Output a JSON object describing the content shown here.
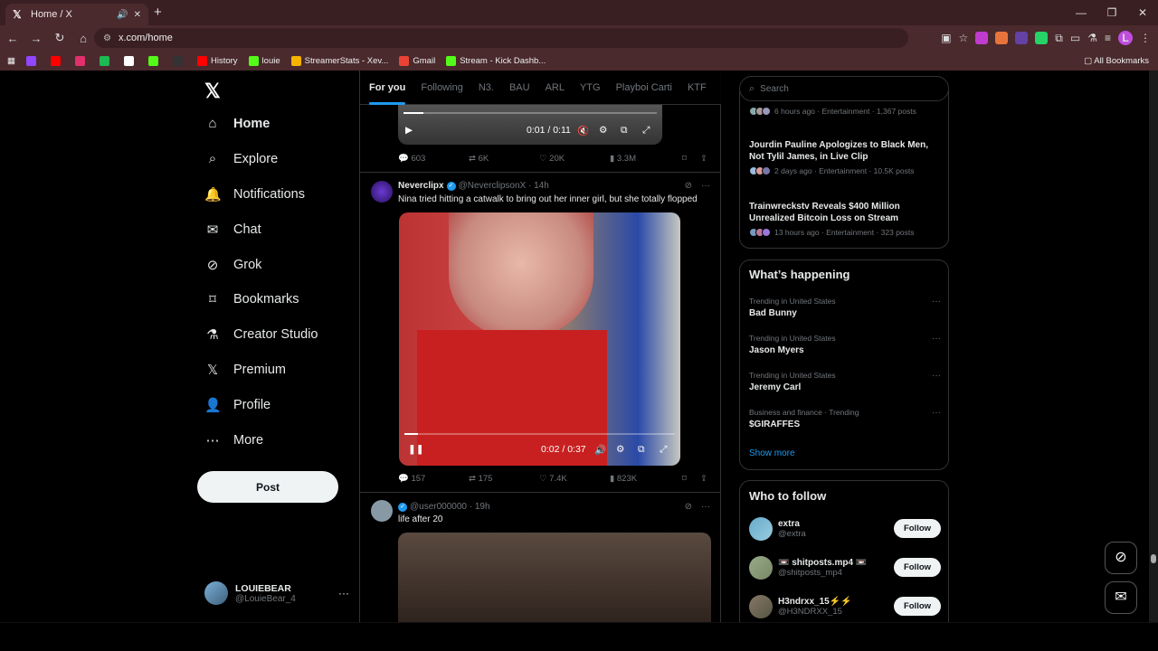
{
  "browser": {
    "tab_title": "Home / X",
    "url": "x.com/home",
    "bookmarks": [
      {
        "label": "",
        "color": "#9146ff"
      },
      {
        "label": "",
        "color": "#ff0000"
      },
      {
        "label": "",
        "color": "#e1306c"
      },
      {
        "label": "",
        "color": "#1db954"
      },
      {
        "label": "",
        "color": "#ffffff"
      },
      {
        "label": "",
        "color": "#53fc18"
      },
      {
        "label": "",
        "color": "#333333"
      },
      {
        "label": "History",
        "color": "#ff0000"
      },
      {
        "label": "louie",
        "color": "#53fc18"
      },
      {
        "label": "StreamerStats - Xev...",
        "color": "#f4b400"
      },
      {
        "label": "Gmail",
        "color": "#ea4335"
      },
      {
        "label": "Stream - Kick Dashb...",
        "color": "#53fc18"
      }
    ],
    "all_bookmarks": "All Bookmarks"
  },
  "nav": {
    "items": [
      {
        "label": "Home",
        "icon": "home"
      },
      {
        "label": "Explore",
        "icon": "search"
      },
      {
        "label": "Notifications",
        "icon": "bell"
      },
      {
        "label": "Chat",
        "icon": "mail"
      },
      {
        "label": "Grok",
        "icon": "grok"
      },
      {
        "label": "Bookmarks",
        "icon": "bookmark"
      },
      {
        "label": "Creator Studio",
        "icon": "flask"
      },
      {
        "label": "Premium",
        "icon": "x"
      },
      {
        "label": "Profile",
        "icon": "person"
      },
      {
        "label": "More",
        "icon": "more"
      }
    ],
    "post_button": "Post",
    "account": {
      "name": "LOUIEBEAR",
      "handle": "@LouieBear_4"
    }
  },
  "feed": {
    "tabs": [
      "For you",
      "Following",
      "N3.",
      "BAU",
      "ARL",
      "YTG",
      "Playboi Carti",
      "KTF"
    ],
    "top_video_time": "0:01 / 0:11",
    "top_actions": {
      "replies": "603",
      "reposts": "6K",
      "likes": "20K",
      "views": "3.3M"
    },
    "post1": {
      "name": "Neverclipx",
      "handle": "@NeverclipsonX · 14h",
      "text": "Nina tried hitting a catwalk to bring out her inner girl, but she totally flopped",
      "video_time": "0:02 / 0:37",
      "progress": 0.05,
      "actions": {
        "replies": "157",
        "reposts": "175",
        "likes": "7.4K",
        "views": "823K"
      }
    },
    "post2": {
      "handle": "@user000000 · 19h",
      "text": "life after 20"
    }
  },
  "sidebar": {
    "search_placeholder": "Search",
    "news": [
      {
        "headline": "",
        "meta": "6 hours ago · Entertainment · 1,367 posts"
      },
      {
        "headline": "Jourdin Pauline Apologizes to Black Men, Not Tylil James, in Live Clip",
        "meta": "2 days ago · Entertainment · 10.5K posts"
      },
      {
        "headline": "Trainwreckstv Reveals $400 Million Unrealized Bitcoin Loss on Stream",
        "meta": "13 hours ago · Entertainment · 323 posts"
      }
    ],
    "happening_title": "What’s happening",
    "trends": [
      {
        "context": "Trending in United States",
        "title": "Bad Bunny"
      },
      {
        "context": "Trending in United States",
        "title": "Jason Myers"
      },
      {
        "context": "Trending in United States",
        "title": "Jeremy Carl"
      },
      {
        "context": "Business and finance · Trending",
        "title": "$GIRAFFES"
      }
    ],
    "show_more": "Show more",
    "wtf_title": "Who to follow",
    "follow_label": "Follow",
    "who_to_follow": [
      {
        "name": "extra",
        "handle": "@extra"
      },
      {
        "name": "📼 shitposts.mp4 📼",
        "handle": "@shitposts_mp4"
      },
      {
        "name": "H3ndrxx_15⚡⚡",
        "handle": "@H3NDRXX_15"
      }
    ]
  }
}
